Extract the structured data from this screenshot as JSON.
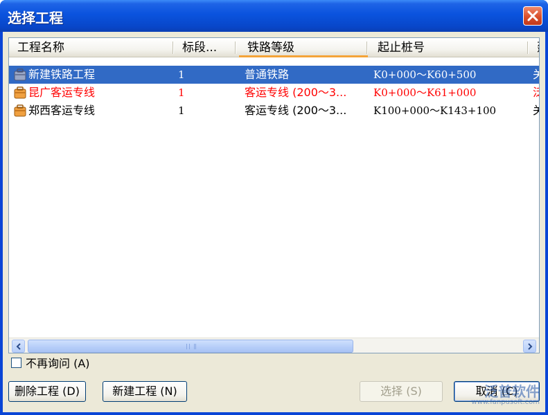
{
  "window": {
    "title": "选择工程"
  },
  "list": {
    "columns": [
      "工程名称",
      "标段...",
      "铁路等级",
      "起止桩号",
      "建"
    ],
    "rows": [
      {
        "name": "新建铁路工程",
        "section": "1",
        "grade": "普通铁路",
        "range": "K0+000～K60+500",
        "extra": "关",
        "state": "selected"
      },
      {
        "name": "昆广客运专线",
        "section": "1",
        "grade": "客运专线 (200～3...",
        "range": "K0+000～K61+000",
        "extra": "泛",
        "state": "red"
      },
      {
        "name": "郑西客运专线",
        "section": "1",
        "grade": "客运专线 (200～3...",
        "range": "K100+000～K143+100",
        "extra": "关",
        "state": "normal"
      }
    ]
  },
  "options": {
    "no_ask_label": "不再询问 (A)",
    "no_ask_checked": false
  },
  "buttons": {
    "delete": "删除工程 (D)",
    "new": "新建工程 (N)",
    "select": "选择 (S)",
    "cancel": "取消 (C)"
  },
  "watermark": {
    "name": "泛普软件",
    "url": "www.fanpusoft.com"
  },
  "colors": {
    "title_bar": "#0a53de",
    "selection": "#316ac5",
    "red_row": "#ff0000",
    "dialog_bg": "#ece9d8"
  }
}
